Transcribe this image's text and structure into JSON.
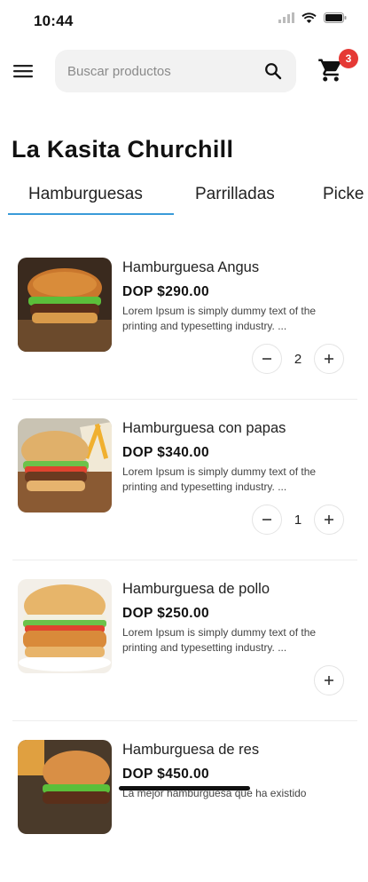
{
  "status_bar": {
    "time": "10:44"
  },
  "search": {
    "placeholder": "Buscar productos"
  },
  "cart": {
    "count": "3"
  },
  "store": {
    "title": "La Kasita Churchill"
  },
  "tabs": [
    {
      "label": "Hamburguesas",
      "active": true
    },
    {
      "label": "Parrilladas",
      "active": false
    },
    {
      "label": "Picke",
      "active": false
    }
  ],
  "products": [
    {
      "name": "Hamburguesa Angus",
      "price": "DOP $290.00",
      "description": "Lorem Ipsum is simply dummy text of the printing and typesetting industry. ...",
      "quantity": "2"
    },
    {
      "name": "Hamburguesa con papas",
      "price": "DOP $340.00",
      "description": "Lorem Ipsum is simply dummy text of the printing and typesetting industry. ...",
      "quantity": "1"
    },
    {
      "name": "Hamburguesa de pollo",
      "price": "DOP $250.00",
      "description": "Lorem Ipsum is simply dummy text of the printing and typesetting industry. ...",
      "quantity": ""
    },
    {
      "name": "Hamburguesa de res",
      "price": "DOP $450.00",
      "description": "La mejor hamburguesa que ha existido",
      "quantity": ""
    }
  ],
  "stepper": {
    "minus_icon": "minus-icon",
    "plus_icon": "plus-icon"
  },
  "colors": {
    "accent": "#3a9bd9",
    "badge": "#e53935"
  }
}
